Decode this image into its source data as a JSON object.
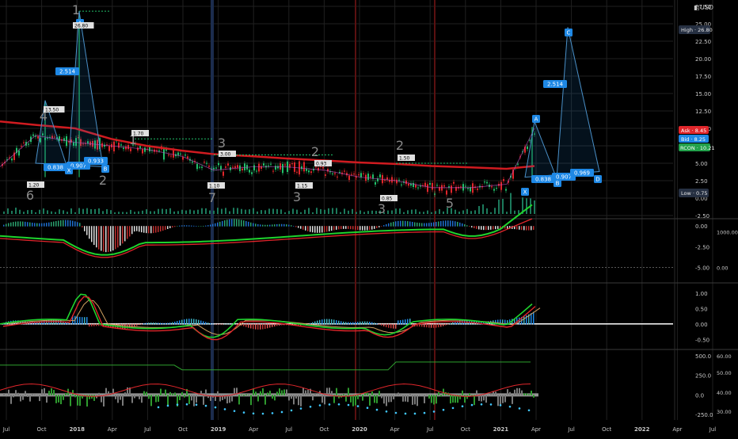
{
  "header": {
    "currency": "USD"
  },
  "price_badges": {
    "high": "High · 26.80",
    "ask": "Ask · 8.45",
    "bid": "Bid · 8.25",
    "symbol": "RCON · 10.21",
    "low": "Low · 0.75"
  },
  "colors": {
    "up": "#21c06a",
    "down": "#e0262b",
    "pattern": "#1e88e5",
    "ma": "#d01b20",
    "green_line": "#1fd32e",
    "axis_text": "#c8c8c8",
    "grid": "#202020"
  },
  "pattern": {
    "left_ratios": [
      "2.514",
      "0.838",
      "0.907",
      "0.933"
    ],
    "left_points": [
      "A",
      "X",
      "B"
    ],
    "right_ratios": [
      "2.514",
      "0.838",
      "0.907",
      "0.969"
    ],
    "right_points": [
      "C",
      "A",
      "X",
      "B",
      "D"
    ]
  },
  "wave_labels": [
    "4",
    "6",
    "2",
    "1",
    "3",
    "7",
    "3",
    "2",
    "3",
    "2",
    "5",
    "1"
  ],
  "price_markers": [
    "1.20",
    "26.80",
    "13.50",
    "1.70",
    "3.00",
    "1.10",
    "1.15",
    "0.93",
    "0.85",
    "1.50"
  ],
  "sub_axes": {
    "panel1": [
      "0.00",
      "-2.50",
      "-5.00"
    ],
    "panel1_right": [
      "1000.00",
      "0.00"
    ],
    "panel2": [
      "1.00",
      "0.50",
      "0.00",
      "-0.50"
    ],
    "panel3": [
      "500.0",
      "250.0",
      "0.0",
      "-250.0"
    ],
    "panel3_right": [
      "60.00",
      "50.00",
      "40.00",
      "30.00"
    ]
  },
  "x_axis": [
    "Jul",
    "Oct",
    "2018",
    "Apr",
    "Jul",
    "Oct",
    "2019",
    "Apr",
    "Jul",
    "Oct",
    "2020",
    "Apr",
    "Jul",
    "Oct",
    "2021",
    "Apr",
    "Jul",
    "Oct",
    "2022",
    "Apr",
    "Jul"
  ],
  "chart_data": [
    {
      "type": "line",
      "x": [
        "2017-07",
        "2017-10",
        "2018-01",
        "2018-04",
        "2018-07",
        "2018-10",
        "2019-01",
        "2019-04",
        "2019-07",
        "2019-10",
        "2020-01",
        "2020-04",
        "2020-07",
        "2020-10",
        "2021-01",
        "2021-03"
      ],
      "series": [
        {
          "values": [
            4.5,
            9.0,
            8.0,
            7.5,
            7.0,
            6.0,
            4.0,
            4.5,
            4.5,
            4.0,
            3.0,
            2.5,
            1.5,
            1.5,
            2.0,
            10.0
          ]
        },
        {
          "values": [
            11.0,
            10.5,
            10.0,
            8.5,
            7.5,
            6.8,
            6.3,
            6.0,
            5.7,
            5.4,
            5.1,
            4.9,
            4.6,
            4.4,
            4.2,
            4.6
          ]
        }
      ],
      "ylim": [
        -2.5,
        27.5
      ],
      "yticks": [
        -2.5,
        0.0,
        2.5,
        5.0,
        7.5,
        10.0,
        12.5,
        15.0,
        17.5,
        20.0,
        22.5,
        25.0,
        27.5
      ]
    },
    {
      "type": "bar",
      "ylim": [
        -6.5,
        0.5
      ],
      "yticks": [
        0.0,
        -2.5,
        -5.0
      ]
    },
    {
      "type": "line",
      "ylim": [
        -0.75,
        1.25
      ],
      "yticks": [
        1.0,
        0.5,
        0.0,
        -0.5
      ]
    },
    {
      "type": "bar",
      "ylim": [
        -300,
        550
      ],
      "yticks": [
        500.0,
        250.0,
        0.0,
        -250.0
      ]
    }
  ]
}
